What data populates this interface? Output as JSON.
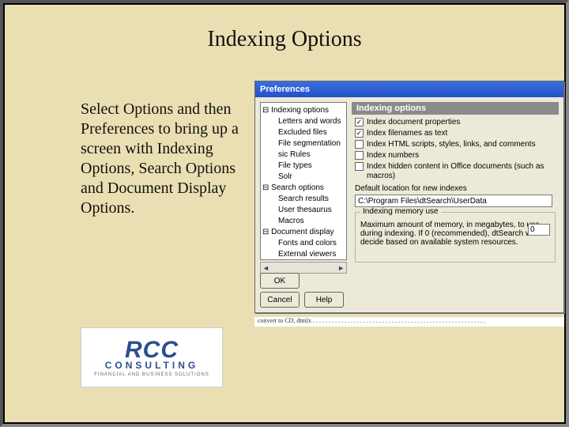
{
  "slide": {
    "title": "Indexing Options",
    "body": "Select Options and then Preferences to bring up a screen with Indexing Options, Search Options and Document Display Options."
  },
  "logo": {
    "big": "RCC",
    "mid": "CONSULTING",
    "small": "FINANCIAL AND BUSINESS SOLUTIONS"
  },
  "dialog": {
    "title": "Preferences",
    "tree": {
      "root1": "Indexing options",
      "root1_children": [
        "Letters and words",
        "Excluded files",
        "File segmentation",
        "sic Rules",
        "File types",
        "Solr"
      ],
      "root2": "Search options",
      "root2_children": [
        "Search results",
        "User thesaurus",
        "Macros"
      ],
      "root3": "Document display",
      "root3_children": [
        "Fonts and colors",
        "External viewers"
      ]
    },
    "right": {
      "header": "Indexing options",
      "chk1": {
        "label": "Index document properties",
        "checked": true
      },
      "chk2": {
        "label": "Index filenames as text",
        "checked": true
      },
      "chk3": {
        "label": "Index HTML scripts, styles, links, and comments",
        "checked": false
      },
      "chk4": {
        "label": "Index numbers",
        "checked": false
      },
      "chk5": {
        "label": "Index hidden content in Office documents (such as macros)",
        "checked": false
      },
      "loc_label": "Default location for new indexes",
      "loc_value": "C:\\Program Files\\dtSearch\\UserData",
      "group_legend": "Indexing memory use",
      "mem_text": "Maximum amount of memory, in megabytes, to use during indexing.  If 0 (recommended), dtSearch will decide based on available system resources.",
      "mem_value": "0"
    },
    "buttons": {
      "ok": "OK",
      "cancel": "Cancel",
      "help": "Help"
    }
  },
  "strip": "convert to CD,  dtmlx . . . . . . . . . . . . . . . . . . . . . . . . . . . . . . . . . . . . . . . . . . . . . . . . . . . . . . ."
}
